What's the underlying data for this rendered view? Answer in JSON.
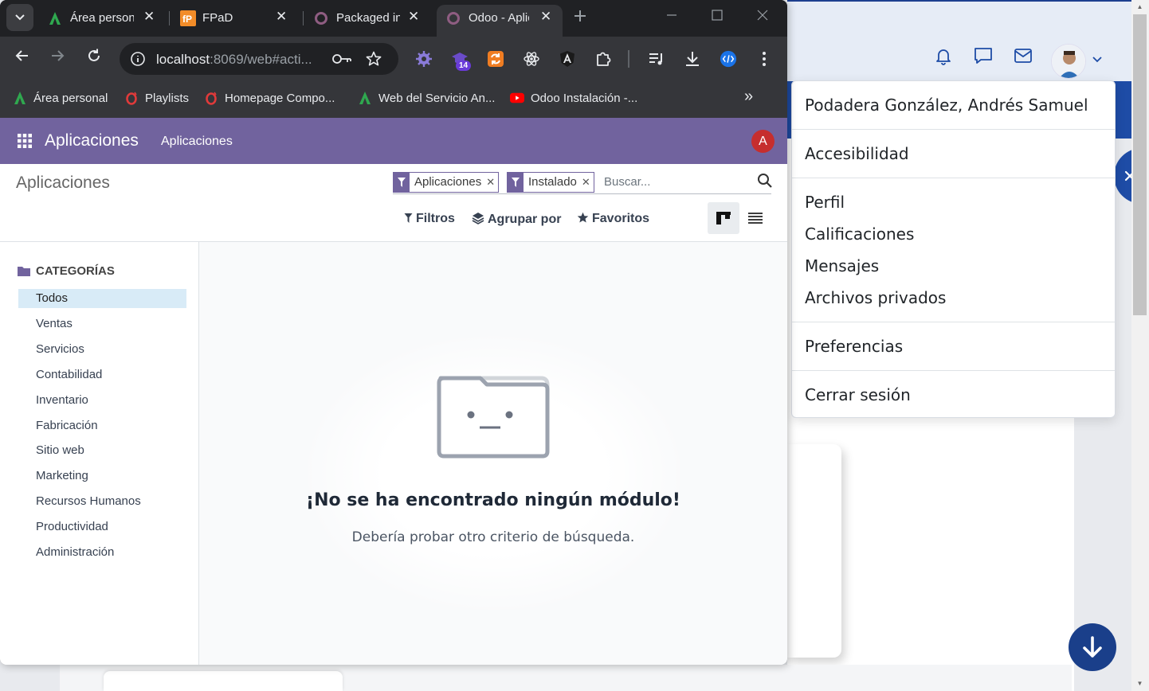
{
  "browser": {
    "tabs": [
      {
        "title": "Área personal",
        "active": false
      },
      {
        "title": "FPaD",
        "active": false
      },
      {
        "title": "Packaged in",
        "active": false
      },
      {
        "title": "Odoo - Aplicaciones",
        "active": true
      }
    ],
    "url_host": "localhost",
    "url_rest": ":8069/web#acti...",
    "extensions_badge": "14",
    "bookmarks": [
      {
        "label": "Área personal",
        "icon": "moodle-a-icon"
      },
      {
        "label": "Playlists",
        "icon": "opera-o-icon"
      },
      {
        "label": "Homepage Compo...",
        "icon": "opera-o-icon"
      },
      {
        "label": "Web del Servicio An...",
        "icon": "moodle-a-icon"
      },
      {
        "label": "Odoo Instalación -...",
        "icon": "youtube-icon"
      }
    ],
    "bookmarks_overflow": "»"
  },
  "odoo": {
    "navbar": {
      "brand": "Aplicaciones",
      "menu": "Aplicaciones",
      "avatar_initial": "A",
      "accent": "#71639e"
    },
    "breadcrumb": "Aplicaciones",
    "search": {
      "facets": [
        {
          "label": "Aplicaciones"
        },
        {
          "label": "Instalado"
        }
      ],
      "placeholder": "Buscar..."
    },
    "controls": {
      "filters": "Filtros",
      "group_by": "Agrupar por",
      "favorites": "Favoritos"
    },
    "sidebar": {
      "header": "CATEGORÍAS",
      "items": [
        "Todos",
        "Ventas",
        "Servicios",
        "Contabilidad",
        "Inventario",
        "Fabricación",
        "Sitio web",
        "Marketing",
        "Recursos Humanos",
        "Productividad",
        "Administración"
      ],
      "active_index": 0
    },
    "empty_state": {
      "title": "¡No se ha encontrado ningún módulo!",
      "subtitle": "Debería probar otro criterio de búsqueda."
    }
  },
  "user_menu": {
    "name": "Podadera González, Andrés Samuel",
    "accessibility": "Accesibilidad",
    "profile": "Perfil",
    "grades": "Calificaciones",
    "messages": "Mensajes",
    "private_files": "Archivos privados",
    "preferences": "Preferencias",
    "logout": "Cerrar sesión"
  },
  "background": {
    "side_tab_glyph": "‹",
    "accent": "#1e4ca6"
  }
}
